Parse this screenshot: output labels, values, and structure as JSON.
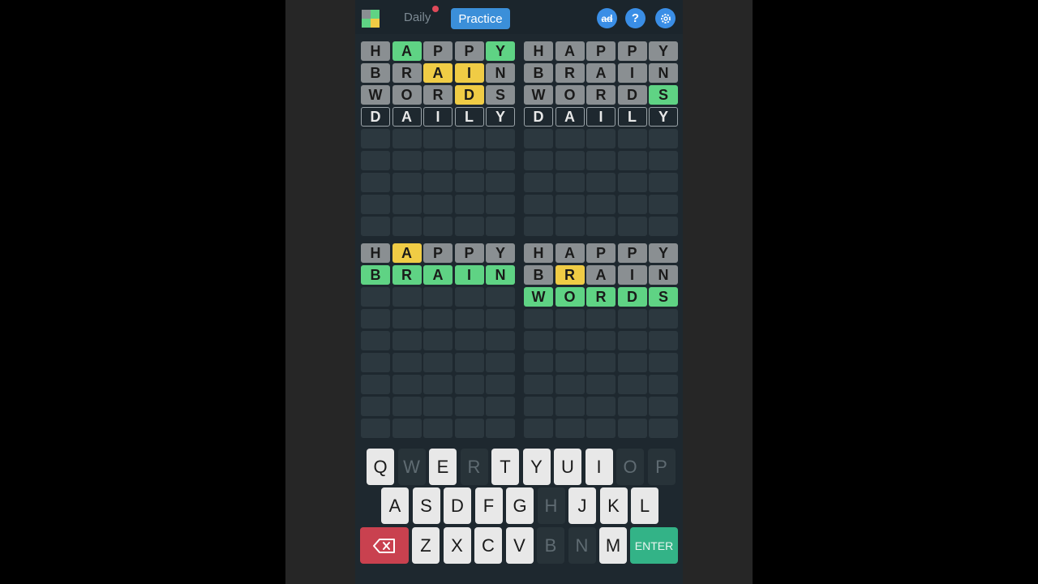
{
  "header": {
    "daily_label": "Daily",
    "practice_label": "Practice",
    "ad_label": "ad",
    "help_label": "?"
  },
  "colors": {
    "correct": "#5fd384",
    "present": "#f0cc45",
    "absent": "#8a8f92",
    "accent": "#3b8fd9",
    "delete": "#c9414f",
    "enter": "#33b387"
  },
  "boards": [
    {
      "rows": [
        [
          [
            "H",
            "a"
          ],
          [
            "A",
            "g"
          ],
          [
            "P",
            "a"
          ],
          [
            "P",
            "a"
          ],
          [
            "Y",
            "g"
          ]
        ],
        [
          [
            "B",
            "a"
          ],
          [
            "R",
            "a"
          ],
          [
            "A",
            "y"
          ],
          [
            "I",
            "y"
          ],
          [
            "N",
            "a"
          ]
        ],
        [
          [
            "W",
            "a"
          ],
          [
            "O",
            "a"
          ],
          [
            "R",
            "a"
          ],
          [
            "D",
            "y"
          ],
          [
            "S",
            "a"
          ]
        ],
        [
          [
            "D",
            "c"
          ],
          [
            "A",
            "c"
          ],
          [
            "I",
            "c"
          ],
          [
            "L",
            "c"
          ],
          [
            "Y",
            "c"
          ]
        ]
      ]
    },
    {
      "rows": [
        [
          [
            "H",
            "a"
          ],
          [
            "A",
            "a"
          ],
          [
            "P",
            "a"
          ],
          [
            "P",
            "a"
          ],
          [
            "Y",
            "a"
          ]
        ],
        [
          [
            "B",
            "a"
          ],
          [
            "R",
            "a"
          ],
          [
            "A",
            "a"
          ],
          [
            "I",
            "a"
          ],
          [
            "N",
            "a"
          ]
        ],
        [
          [
            "W",
            "a"
          ],
          [
            "O",
            "a"
          ],
          [
            "R",
            "a"
          ],
          [
            "D",
            "a"
          ],
          [
            "S",
            "g"
          ]
        ],
        [
          [
            "D",
            "c"
          ],
          [
            "A",
            "c"
          ],
          [
            "I",
            "c"
          ],
          [
            "L",
            "c"
          ],
          [
            "Y",
            "c"
          ]
        ]
      ]
    },
    {
      "rows": [
        [
          [
            "H",
            "a"
          ],
          [
            "A",
            "y"
          ],
          [
            "P",
            "a"
          ],
          [
            "P",
            "a"
          ],
          [
            "Y",
            "a"
          ]
        ],
        [
          [
            "B",
            "g"
          ],
          [
            "R",
            "g"
          ],
          [
            "A",
            "g"
          ],
          [
            "I",
            "g"
          ],
          [
            "N",
            "g"
          ]
        ]
      ]
    },
    {
      "rows": [
        [
          [
            "H",
            "a"
          ],
          [
            "A",
            "a"
          ],
          [
            "P",
            "a"
          ],
          [
            "P",
            "a"
          ],
          [
            "Y",
            "a"
          ]
        ],
        [
          [
            "B",
            "a"
          ],
          [
            "R",
            "y"
          ],
          [
            "A",
            "a"
          ],
          [
            "I",
            "a"
          ],
          [
            "N",
            "a"
          ]
        ],
        [
          [
            "W",
            "g"
          ],
          [
            "O",
            "g"
          ],
          [
            "R",
            "g"
          ],
          [
            "D",
            "g"
          ],
          [
            "S",
            "g"
          ]
        ]
      ]
    }
  ],
  "keyboard": {
    "rows": [
      [
        [
          "Q",
          "light"
        ],
        [
          "W",
          "dim"
        ],
        [
          "E",
          "light"
        ],
        [
          "R",
          "dim"
        ],
        [
          "T",
          "light"
        ],
        [
          "Y",
          "light"
        ],
        [
          "U",
          "light"
        ],
        [
          "I",
          "light"
        ],
        [
          "O",
          "dim"
        ],
        [
          "P",
          "dim"
        ]
      ],
      [
        [
          "A",
          "light"
        ],
        [
          "S",
          "light"
        ],
        [
          "D",
          "light"
        ],
        [
          "F",
          "light"
        ],
        [
          "G",
          "light"
        ],
        [
          "H",
          "dim"
        ],
        [
          "J",
          "light"
        ],
        [
          "K",
          "light"
        ],
        [
          "L",
          "light"
        ]
      ],
      [
        [
          "Z",
          "light"
        ],
        [
          "X",
          "light"
        ],
        [
          "C",
          "light"
        ],
        [
          "V",
          "light"
        ],
        [
          "B",
          "dim"
        ],
        [
          "N",
          "dim"
        ],
        [
          "M",
          "light"
        ]
      ]
    ],
    "enter_label": "ENTER"
  }
}
